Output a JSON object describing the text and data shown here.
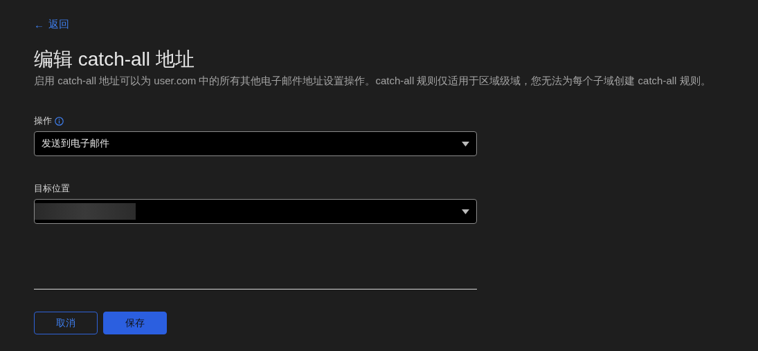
{
  "back_link": {
    "icon": "←",
    "label": "返回"
  },
  "title": "编辑 catch-all 地址",
  "description": "启用 catch-all 地址可以为 user.com 中的所有其他电子邮件地址设置操作。catch-all 规则仅适用于区域级域，您无法为每个子域创建 catch-all 规则。",
  "fields": [
    {
      "label": "操作",
      "info": true,
      "value": "发送到电子邮件",
      "redacted": false
    },
    {
      "label": "目标位置",
      "info": false,
      "redacted": true
    }
  ],
  "buttons": [
    {
      "label": "取消",
      "kind": "secondary"
    },
    {
      "label": "保存",
      "kind": "primary"
    }
  ]
}
